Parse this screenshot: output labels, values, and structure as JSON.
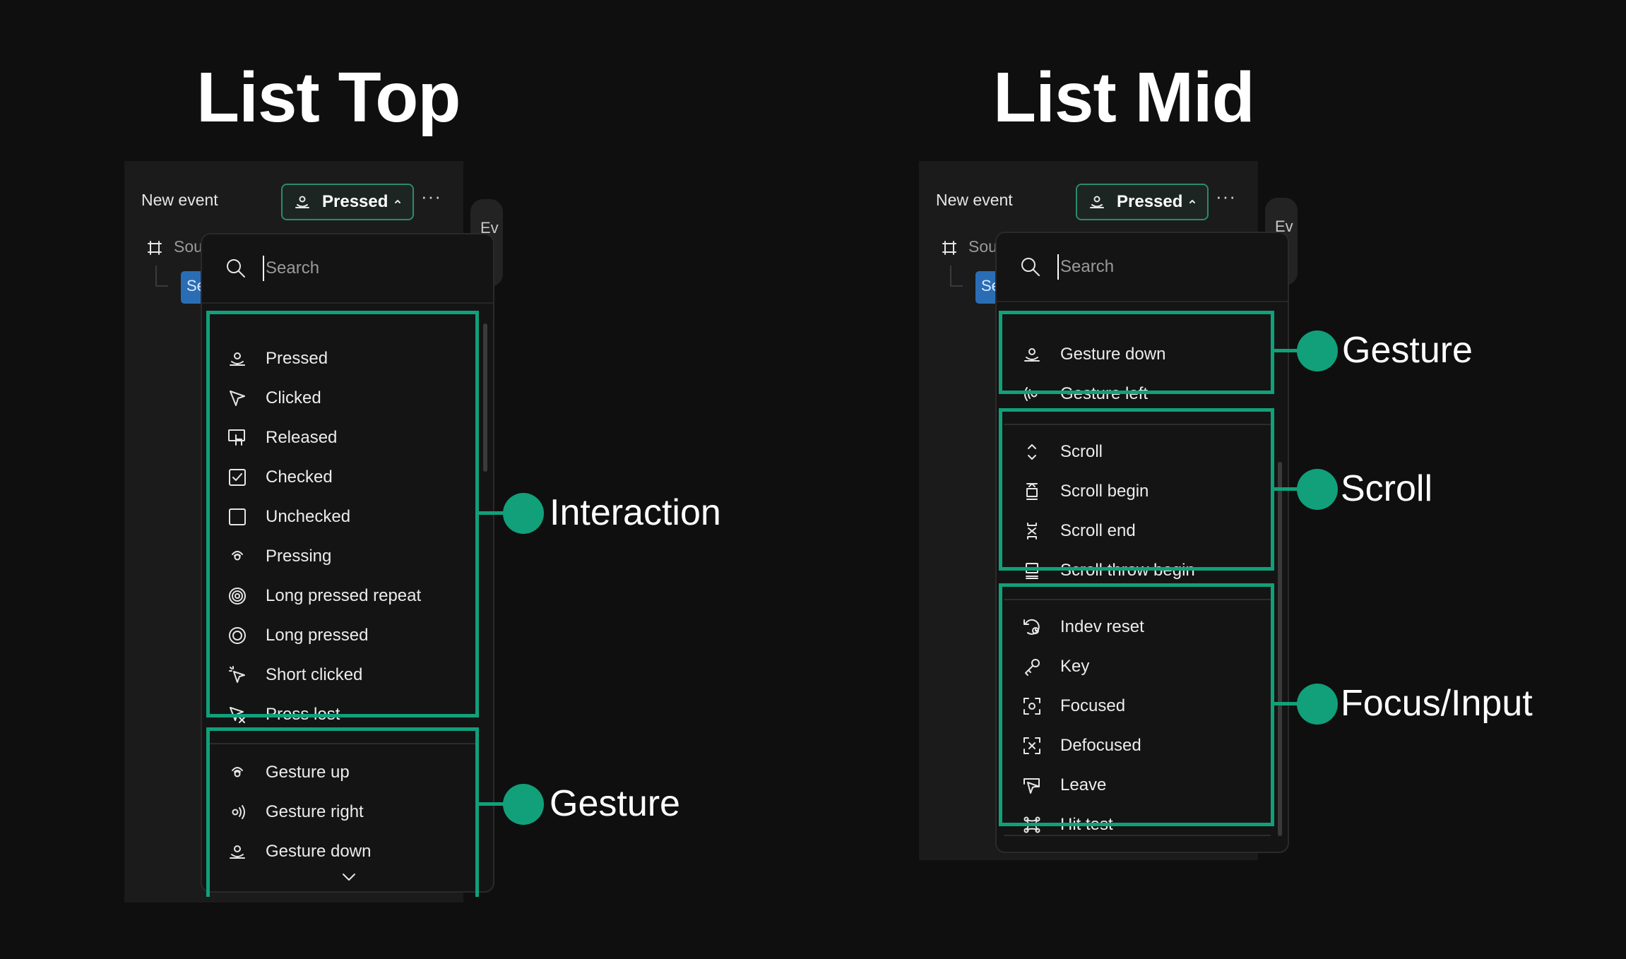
{
  "left": {
    "title": "List Top",
    "panel": {
      "new_event_label": "New event",
      "trigger": {
        "label": "Pressed",
        "icon": "pressed-icon"
      },
      "more_label": "···",
      "tree_label": "Sou",
      "tree_chip": "Se",
      "side_tab": "Ev"
    },
    "dropdown": {
      "search_placeholder": "Search",
      "items": [
        {
          "label": "Pressed",
          "icon": "pressed-icon"
        },
        {
          "label": "Clicked",
          "icon": "cursor-icon"
        },
        {
          "label": "Released",
          "icon": "released-icon"
        },
        {
          "label": "Checked",
          "icon": "checkbox-checked-icon"
        },
        {
          "label": "Unchecked",
          "icon": "checkbox-empty-icon"
        },
        {
          "label": "Pressing",
          "icon": "pressing-icon"
        },
        {
          "label": "Long pressed repeat",
          "icon": "long-pressed-repeat-icon"
        },
        {
          "label": "Long pressed",
          "icon": "long-pressed-icon"
        },
        {
          "label": "Short clicked",
          "icon": "short-clicked-icon"
        },
        {
          "label": "Press lost",
          "icon": "press-lost-icon"
        },
        {
          "label": "Gesture up",
          "icon": "gesture-up-icon"
        },
        {
          "label": "Gesture right",
          "icon": "gesture-right-icon"
        },
        {
          "label": "Gesture down",
          "icon": "gesture-down-icon"
        }
      ]
    },
    "categories": [
      "Interaction",
      "Gesture"
    ]
  },
  "right": {
    "title": "List Mid",
    "panel": {
      "new_event_label": "New event",
      "trigger": {
        "label": "Pressed",
        "icon": "pressed-icon"
      },
      "more_label": "···",
      "tree_label": "Sou",
      "tree_chip": "Se",
      "side_tab": "Ev"
    },
    "dropdown": {
      "search_placeholder": "Search",
      "items": [
        {
          "label": "Gesture down",
          "icon": "gesture-down-icon"
        },
        {
          "label": "Gesture left",
          "icon": "gesture-left-icon"
        },
        {
          "label": "Scroll",
          "icon": "scroll-icon"
        },
        {
          "label": "Scroll begin",
          "icon": "scroll-begin-icon"
        },
        {
          "label": "Scroll end",
          "icon": "scroll-end-icon"
        },
        {
          "label": "Scroll throw begin",
          "icon": "scroll-throw-begin-icon"
        },
        {
          "label": "Indev reset",
          "icon": "indev-reset-icon"
        },
        {
          "label": "Key",
          "icon": "key-icon"
        },
        {
          "label": "Focused",
          "icon": "focused-icon"
        },
        {
          "label": "Defocused",
          "icon": "defocused-icon"
        },
        {
          "label": "Leave",
          "icon": "leave-icon"
        },
        {
          "label": "Hit test",
          "icon": "hit-test-icon"
        }
      ]
    },
    "categories": [
      "Gesture",
      "Scroll",
      "Focus/Input"
    ]
  },
  "colors": {
    "accent": "#11a07a",
    "background": "#0f0f0f",
    "panel": "#1b1b1b",
    "dropdown": "#141414"
  }
}
